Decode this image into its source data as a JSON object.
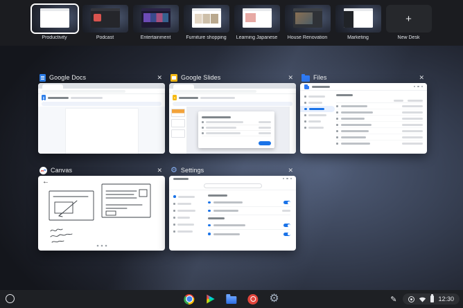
{
  "desks": {
    "items": [
      {
        "label": "Productivity",
        "active": true
      },
      {
        "label": "Podcast",
        "active": false
      },
      {
        "label": "Entertainment",
        "active": false
      },
      {
        "label": "Furniture shopping",
        "active": false
      },
      {
        "label": "Learning Japanese",
        "active": false
      },
      {
        "label": "House Renovation",
        "active": false
      },
      {
        "label": "Marketing",
        "active": false
      }
    ],
    "new_desk_label": "New Desk"
  },
  "windows": [
    {
      "title": "Google Docs",
      "icon": "google-docs-icon"
    },
    {
      "title": "Google Slides",
      "icon": "google-slides-icon"
    },
    {
      "title": "Files",
      "icon": "files-folder-icon"
    },
    {
      "title": "Canvas",
      "icon": "canvas-icon"
    },
    {
      "title": "Settings",
      "icon": "settings-gear-icon"
    }
  ],
  "shelf": {
    "time": "12:30",
    "apps": [
      "launcher",
      "chrome",
      "play-store",
      "files",
      "red-app",
      "settings"
    ]
  },
  "icons": {
    "close": "✕",
    "plus": "+",
    "gear": "⚙",
    "stylus": "✎",
    "back": "←"
  },
  "colors": {
    "accent_blue": "#1a73e8",
    "docs_blue": "#2b7de9",
    "slides_yellow": "#f5ba15",
    "files_blue": "#2f7bf6",
    "toggle_blue": "#1a73e8",
    "selection_blue": "#e8f0fe",
    "chrome_red": "#ea4335",
    "chrome_yellow": "#fbbc04",
    "chrome_green": "#34a853",
    "chrome_blue": "#4285f4"
  }
}
